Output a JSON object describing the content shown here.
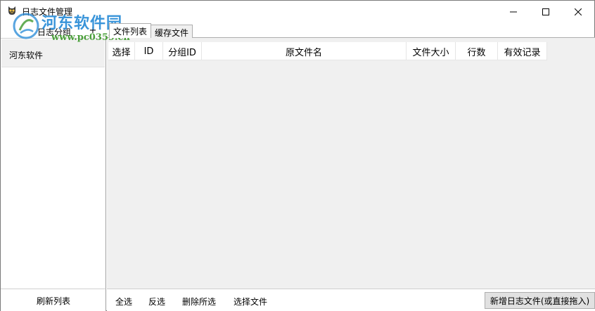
{
  "window": {
    "title": "日志文件管理"
  },
  "watermark": {
    "site_name": "河东软件园",
    "url": "www.pc0359.cn"
  },
  "left_panel": {
    "tab_label": "日志分组",
    "add_label": "+",
    "groups": [
      {
        "label": "河东软件"
      }
    ],
    "refresh_label": "刷新列表"
  },
  "right_panel": {
    "tabs": [
      {
        "label": "文件列表",
        "active": true
      },
      {
        "label": "缓存文件",
        "active": false
      }
    ],
    "table": {
      "columns": [
        "选择",
        "ID",
        "分组ID",
        "原文件名",
        "文件大小",
        "行数",
        "有效记录"
      ],
      "rows": []
    }
  },
  "bottom_bar": {
    "select_all_label": "全选",
    "invert_label": "反选",
    "delete_selected_label": "删除所选",
    "select_file_label": "选择文件",
    "new_log_label": "新增日志文件(或直接拖入)"
  },
  "colors": {
    "watermark_blue": "#2f8fd8",
    "watermark_green": "#4a9f3a",
    "table_background": "#f0f0f0"
  }
}
